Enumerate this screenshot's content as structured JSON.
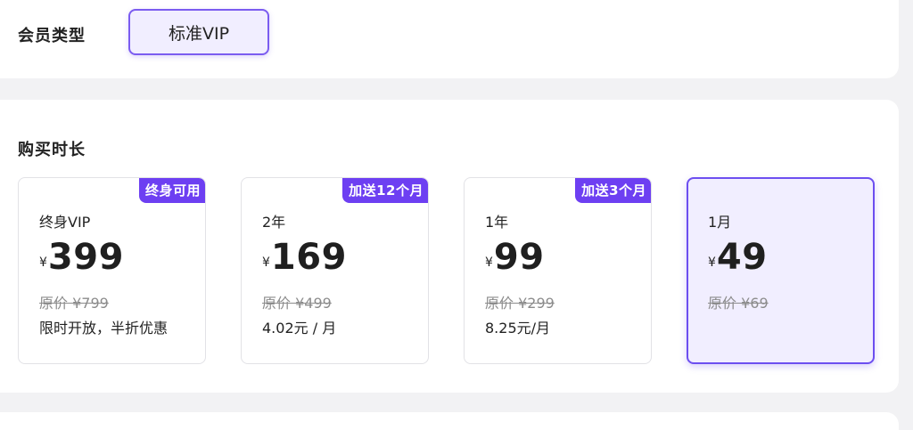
{
  "membership": {
    "label": "会员类型",
    "options": [
      {
        "label": "标准VIP",
        "selected": true
      }
    ]
  },
  "duration": {
    "label": "购买时长",
    "plans": [
      {
        "tag": "终身可用",
        "name": "终身VIP",
        "currency": "¥",
        "price": "399",
        "original": "原价 ¥799",
        "note": "限时开放，半折优惠",
        "selected": false
      },
      {
        "tag": "加送12个月",
        "name": "2年",
        "currency": "¥",
        "price": "169",
        "original": "原价 ¥499",
        "note": "4.02元 / 月",
        "selected": false
      },
      {
        "tag": "加送3个月",
        "name": "1年",
        "currency": "¥",
        "price": "99",
        "original": "原价 ¥299",
        "note": "8.25元/月",
        "selected": false
      },
      {
        "tag": "",
        "name": "1月",
        "currency": "¥",
        "price": "49",
        "original": "原价 ¥69",
        "note": "",
        "selected": true
      }
    ]
  },
  "colors": {
    "accent": "#6d3ff2",
    "selected_bg": "#f1eeff",
    "page_bg": "#f2f2f4"
  }
}
